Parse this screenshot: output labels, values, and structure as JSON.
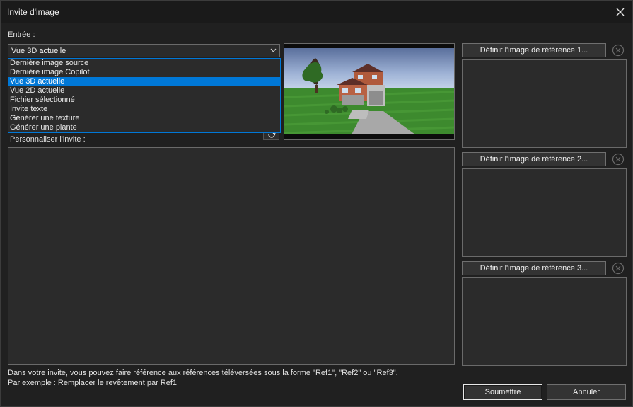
{
  "window": {
    "title": "Invite d'image"
  },
  "input_section": {
    "label": "Entrée :",
    "selected_value": "Vue 3D actuelle",
    "options": [
      "Dernière image source",
      "Dernière image Copilot",
      "Vue 3D actuelle",
      "Vue 2D actuelle",
      "Fichier sélectionné",
      "Invite texte",
      "Générer une texture",
      "Générer une plante"
    ],
    "selected_index": 2
  },
  "prompt": {
    "label": "Personnaliser l'invite :",
    "value": ""
  },
  "hints": {
    "line1": "Dans votre invite, vous pouvez faire référence aux références téléversées sous la forme \"Ref1\", \"Ref2\" ou \"Ref3\".",
    "line2": "Par exemple : Remplacer le revêtement par Ref1"
  },
  "references": [
    {
      "button_label": "Définir l'image de référence 1..."
    },
    {
      "button_label": "Définir l'image de référence 2..."
    },
    {
      "button_label": "Définir l'image de référence 3..."
    }
  ],
  "actions": {
    "submit": "Soumettre",
    "cancel": "Annuler"
  },
  "colors": {
    "background": "#202020",
    "selection": "#0078d7",
    "field": "#2b2b2b"
  }
}
